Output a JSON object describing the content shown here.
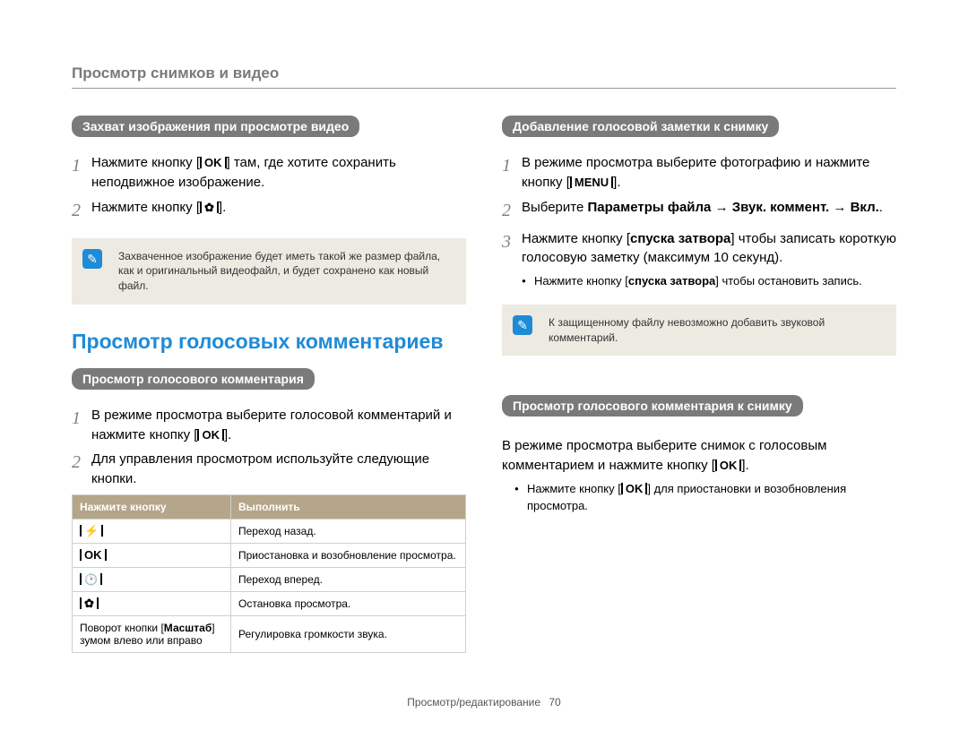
{
  "header": {
    "title": "Просмотр снимков и видео"
  },
  "left": {
    "pill1": "Захват изображения при просмотре видео",
    "step1_a": "Нажмите кнопку [",
    "step1_ok": "OK",
    "step1_b": "] там, где хотите сохранить неподвижное изображение.",
    "step2_a": "Нажмите кнопку [",
    "step2_b": "].",
    "note1": "Захваченное изображение будет иметь такой же размер файла, как и оригинальный видеофайл, и будет сохранено как новый файл.",
    "section": "Просмотр голосовых комментариев",
    "pill2": "Просмотр голосового комментария",
    "s2step1_a": "В режиме просмотра выберите голосовой комментарий и нажмите кнопку [",
    "s2step1_ok": "OK",
    "s2step1_b": "].",
    "s2step2": "Для управления просмотром используйте следующие кнопки.",
    "table": {
      "h1": "Нажмите кнопку",
      "h2": "Выполнить",
      "r1b": "Переход назад.",
      "r2a": "OK",
      "r2b": "Приостановка и возобновление просмотра.",
      "r3b": "Переход вперед.",
      "r4b": "Остановка просмотра.",
      "r5a_pre": "Поворот кнопки [",
      "r5a_bold": "Масштаб",
      "r5a_post": "] зумом влево или вправо",
      "r5b": "Регулировка громкости звука."
    }
  },
  "right": {
    "pill1": "Добавление голосовой заметки к снимку",
    "r1step1_a": "В режиме просмотра выберите фотографию и нажмите кнопку [",
    "r1step1_menu": "MENU",
    "r1step1_b": "].",
    "r1step2_a": "Выберите ",
    "r1step2_bold": "Параметры файла → Звук. коммент. → Вкл.",
    "r1step2_b": ".",
    "r1step3_a": "Нажмите кнопку [",
    "r1step3_bold": "спуска затвора",
    "r1step3_b": "] чтобы записать короткую голосовую заметку (максимум 10 секунд).",
    "r1bullet_a": "Нажмите кнопку [",
    "r1bullet_bold": "спуска затвора",
    "r1bullet_b": "] чтобы остановить запись.",
    "note2": "К защищенному файлу невозможно добавить звуковой комментарий.",
    "pill2": "Просмотр голосового комментария к снимку",
    "r2text_a": "В режиме просмотра выберите снимок с голосовым комментарием и нажмите кнопку [",
    "r2text_ok": "OK",
    "r2text_b": "].",
    "r2bullet_a": "Нажмите кнопку [",
    "r2bullet_ok": "OK",
    "r2bullet_b": "] для приостановки и возобновления просмотра."
  },
  "footer": {
    "label": "Просмотр/редактирование",
    "page": "70"
  }
}
